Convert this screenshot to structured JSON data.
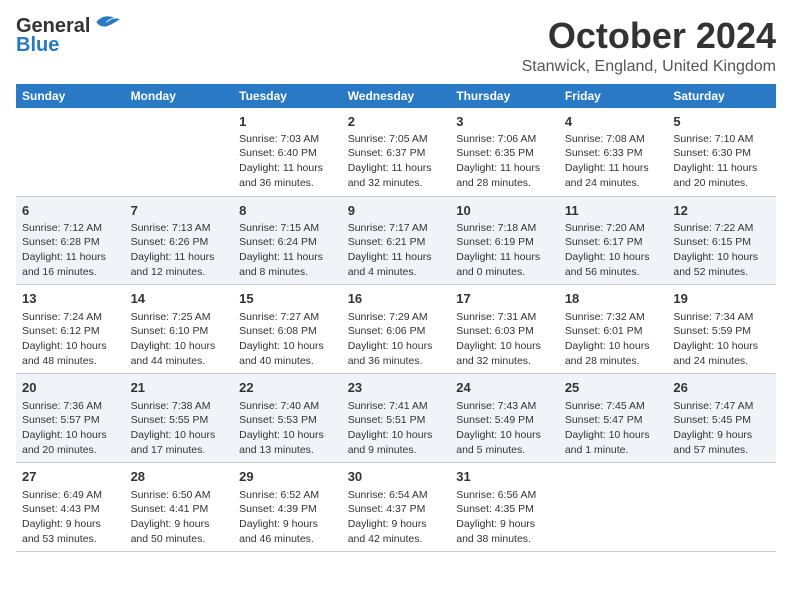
{
  "header": {
    "logo_line1": "General",
    "logo_line2": "Blue",
    "month": "October 2024",
    "location": "Stanwick, England, United Kingdom"
  },
  "weekdays": [
    "Sunday",
    "Monday",
    "Tuesday",
    "Wednesday",
    "Thursday",
    "Friday",
    "Saturday"
  ],
  "weeks": [
    [
      {
        "day": "",
        "info": ""
      },
      {
        "day": "",
        "info": ""
      },
      {
        "day": "1",
        "info": "Sunrise: 7:03 AM\nSunset: 6:40 PM\nDaylight: 11 hours and 36 minutes."
      },
      {
        "day": "2",
        "info": "Sunrise: 7:05 AM\nSunset: 6:37 PM\nDaylight: 11 hours and 32 minutes."
      },
      {
        "day": "3",
        "info": "Sunrise: 7:06 AM\nSunset: 6:35 PM\nDaylight: 11 hours and 28 minutes."
      },
      {
        "day": "4",
        "info": "Sunrise: 7:08 AM\nSunset: 6:33 PM\nDaylight: 11 hours and 24 minutes."
      },
      {
        "day": "5",
        "info": "Sunrise: 7:10 AM\nSunset: 6:30 PM\nDaylight: 11 hours and 20 minutes."
      }
    ],
    [
      {
        "day": "6",
        "info": "Sunrise: 7:12 AM\nSunset: 6:28 PM\nDaylight: 11 hours and 16 minutes."
      },
      {
        "day": "7",
        "info": "Sunrise: 7:13 AM\nSunset: 6:26 PM\nDaylight: 11 hours and 12 minutes."
      },
      {
        "day": "8",
        "info": "Sunrise: 7:15 AM\nSunset: 6:24 PM\nDaylight: 11 hours and 8 minutes."
      },
      {
        "day": "9",
        "info": "Sunrise: 7:17 AM\nSunset: 6:21 PM\nDaylight: 11 hours and 4 minutes."
      },
      {
        "day": "10",
        "info": "Sunrise: 7:18 AM\nSunset: 6:19 PM\nDaylight: 11 hours and 0 minutes."
      },
      {
        "day": "11",
        "info": "Sunrise: 7:20 AM\nSunset: 6:17 PM\nDaylight: 10 hours and 56 minutes."
      },
      {
        "day": "12",
        "info": "Sunrise: 7:22 AM\nSunset: 6:15 PM\nDaylight: 10 hours and 52 minutes."
      }
    ],
    [
      {
        "day": "13",
        "info": "Sunrise: 7:24 AM\nSunset: 6:12 PM\nDaylight: 10 hours and 48 minutes."
      },
      {
        "day": "14",
        "info": "Sunrise: 7:25 AM\nSunset: 6:10 PM\nDaylight: 10 hours and 44 minutes."
      },
      {
        "day": "15",
        "info": "Sunrise: 7:27 AM\nSunset: 6:08 PM\nDaylight: 10 hours and 40 minutes."
      },
      {
        "day": "16",
        "info": "Sunrise: 7:29 AM\nSunset: 6:06 PM\nDaylight: 10 hours and 36 minutes."
      },
      {
        "day": "17",
        "info": "Sunrise: 7:31 AM\nSunset: 6:03 PM\nDaylight: 10 hours and 32 minutes."
      },
      {
        "day": "18",
        "info": "Sunrise: 7:32 AM\nSunset: 6:01 PM\nDaylight: 10 hours and 28 minutes."
      },
      {
        "day": "19",
        "info": "Sunrise: 7:34 AM\nSunset: 5:59 PM\nDaylight: 10 hours and 24 minutes."
      }
    ],
    [
      {
        "day": "20",
        "info": "Sunrise: 7:36 AM\nSunset: 5:57 PM\nDaylight: 10 hours and 20 minutes."
      },
      {
        "day": "21",
        "info": "Sunrise: 7:38 AM\nSunset: 5:55 PM\nDaylight: 10 hours and 17 minutes."
      },
      {
        "day": "22",
        "info": "Sunrise: 7:40 AM\nSunset: 5:53 PM\nDaylight: 10 hours and 13 minutes."
      },
      {
        "day": "23",
        "info": "Sunrise: 7:41 AM\nSunset: 5:51 PM\nDaylight: 10 hours and 9 minutes."
      },
      {
        "day": "24",
        "info": "Sunrise: 7:43 AM\nSunset: 5:49 PM\nDaylight: 10 hours and 5 minutes."
      },
      {
        "day": "25",
        "info": "Sunrise: 7:45 AM\nSunset: 5:47 PM\nDaylight: 10 hours and 1 minute."
      },
      {
        "day": "26",
        "info": "Sunrise: 7:47 AM\nSunset: 5:45 PM\nDaylight: 9 hours and 57 minutes."
      }
    ],
    [
      {
        "day": "27",
        "info": "Sunrise: 6:49 AM\nSunset: 4:43 PM\nDaylight: 9 hours and 53 minutes."
      },
      {
        "day": "28",
        "info": "Sunrise: 6:50 AM\nSunset: 4:41 PM\nDaylight: 9 hours and 50 minutes."
      },
      {
        "day": "29",
        "info": "Sunrise: 6:52 AM\nSunset: 4:39 PM\nDaylight: 9 hours and 46 minutes."
      },
      {
        "day": "30",
        "info": "Sunrise: 6:54 AM\nSunset: 4:37 PM\nDaylight: 9 hours and 42 minutes."
      },
      {
        "day": "31",
        "info": "Sunrise: 6:56 AM\nSunset: 4:35 PM\nDaylight: 9 hours and 38 minutes."
      },
      {
        "day": "",
        "info": ""
      },
      {
        "day": "",
        "info": ""
      }
    ]
  ]
}
